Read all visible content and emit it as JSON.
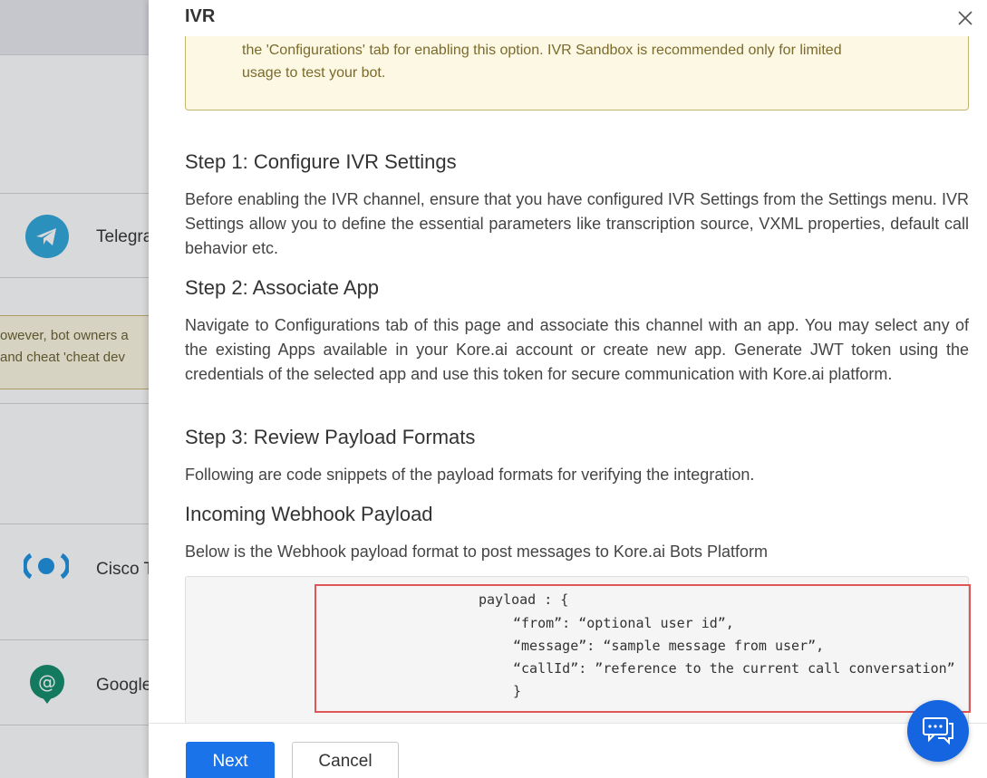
{
  "background": {
    "channels": [
      {
        "label": "Telegra",
        "icon": "telegram-icon"
      },
      {
        "label": "Cisco T",
        "icon": "cisco-webex-icon"
      },
      {
        "label": "Google",
        "icon": "google-chat-icon"
      }
    ],
    "notice": {
      "line1": "owever, bot owners a",
      "line2": " and cheat 'cheat dev"
    }
  },
  "drawer": {
    "title": "IVR",
    "warning": {
      "line1": "the 'Configurations' tab for enabling this option. IVR Sandbox is recommended only for limited",
      "line2": "usage to test your bot."
    },
    "step1": {
      "heading": "Step 1: Configure IVR Settings",
      "text": "Before enabling the IVR channel, ensure that you have configured IVR Settings from the Settings menu. IVR Settings allow you to define the essential parameters like transcription source, VXML properties, default call behavior etc."
    },
    "step2": {
      "heading": "Step 2: Associate App",
      "text": "Navigate to Configurations tab of this page and associate this channel with an app. You may select any of the existing Apps available in your Kore.ai account or create new app. Generate JWT token using the credentials of the selected app and use this token for secure communication with Kore.ai platform."
    },
    "step3": {
      "heading": "Step 3: Review Payload Formats",
      "text": "Following are code snippets of the payload formats for verifying the integration."
    },
    "incoming": {
      "heading": "Incoming Webhook Payload",
      "text": "Below is the Webhook payload format to post messages to Kore.ai Bots Platform"
    },
    "code": [
      "payload : {",
      "“from”: “optional user id”,",
      "“message”: “sample message from user”,",
      "“callId”: ”reference to the current call conversation”",
      "}"
    ],
    "footer": {
      "next_label": "Next",
      "cancel_label": "Cancel"
    }
  },
  "colors": {
    "primary": "#1a73e8",
    "warning_bg": "#fdf8e3",
    "highlight": "#e05555"
  }
}
